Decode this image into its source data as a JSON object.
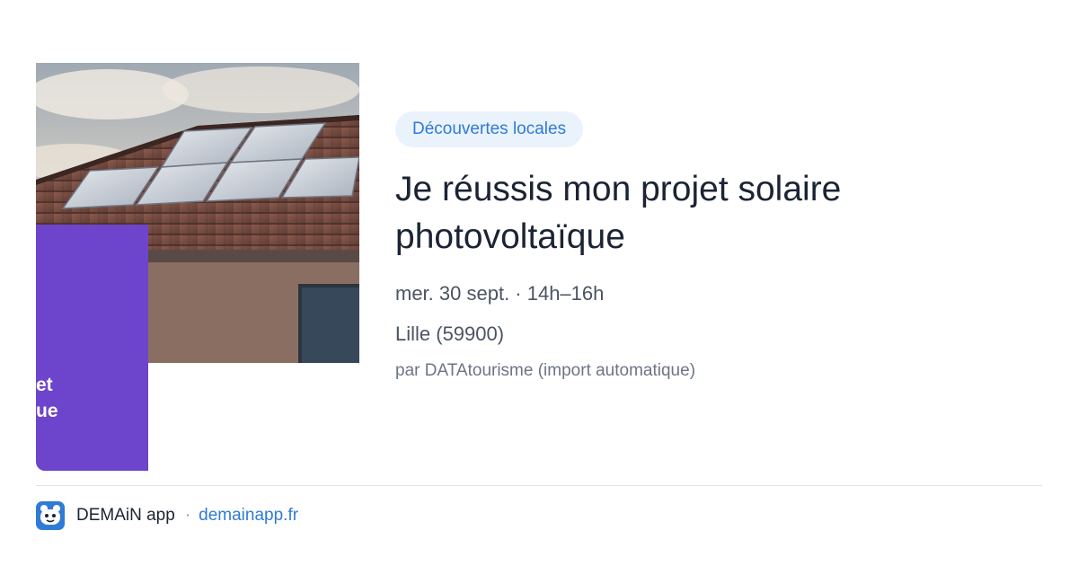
{
  "card": {
    "image": {
      "alt_description": "",
      "overlay_text_line1": "et",
      "overlay_text_line2": "ue",
      "accent_color": "#6d45cc"
    },
    "tag": "Découvertes locales",
    "title": "Je réussis mon projet solaire photovoltaïque",
    "date_time": "mer. 30 sept. · 14h–16h",
    "location": "Lille (59900)",
    "source": "par DATAtourisme (import automatique)"
  },
  "footer": {
    "app_icon": "demain-app-icon",
    "app_name": "DEMAiN app",
    "separator": "·",
    "domain": "demainapp.fr"
  },
  "colors": {
    "tag_bg": "#eaf2fc",
    "tag_text": "#2f7bd6",
    "title": "#1b2434",
    "meta": "#4b5463",
    "link": "#2f7bd6"
  }
}
